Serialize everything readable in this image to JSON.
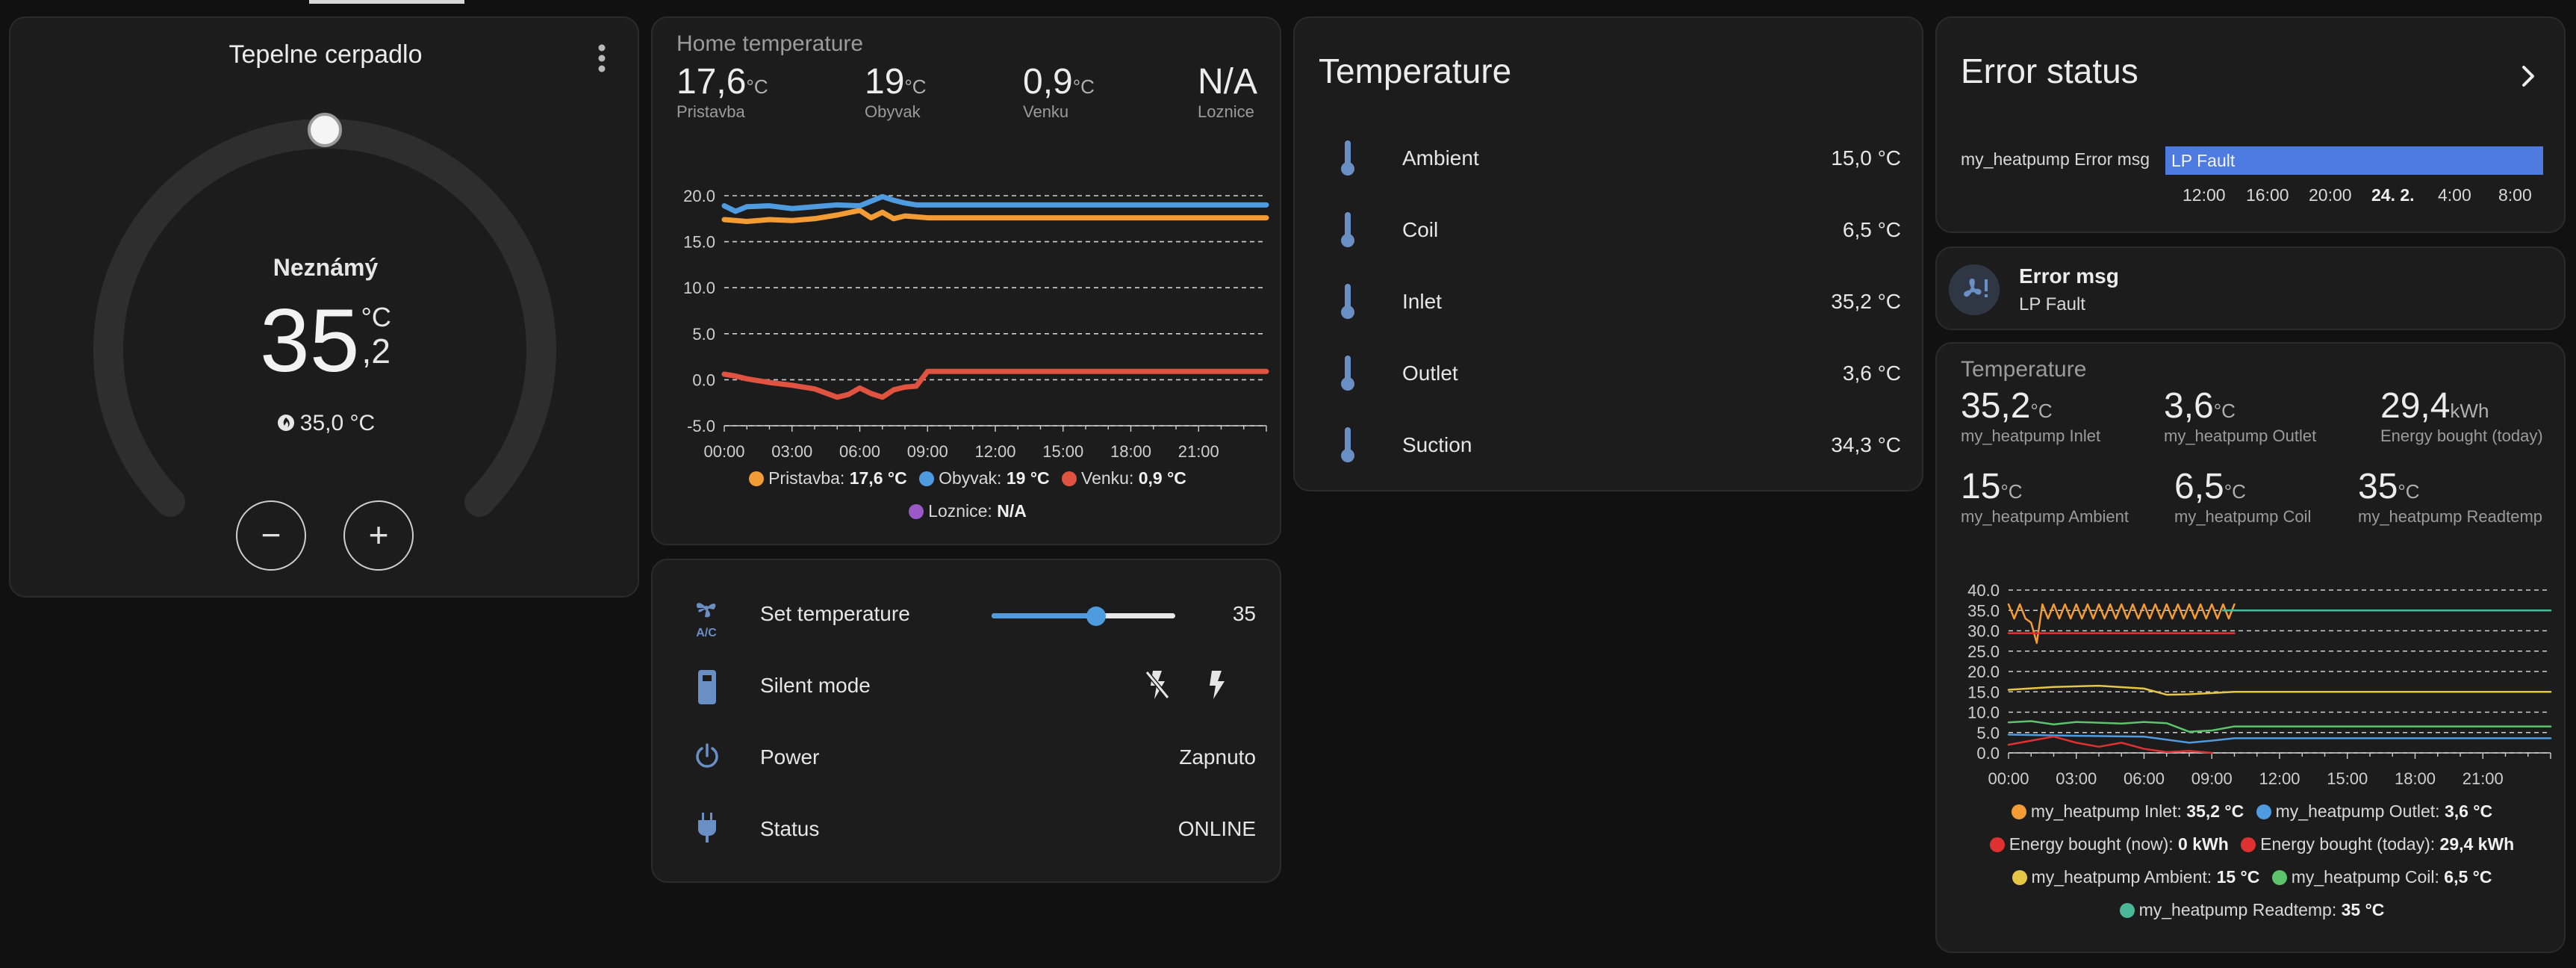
{
  "colors": {
    "orange": "#f39c35",
    "blue": "#4f9be0",
    "red": "#e05340",
    "purple": "#9b59c6",
    "accent_blue": "#4d7be0",
    "icon_blue": "#6a8fc4",
    "yellow": "#e6c645",
    "green": "#5cc46a",
    "teal": "#4bb89a",
    "bright_red": "#e03030"
  },
  "thermostat": {
    "title": "Tepelne cerpadlo",
    "state": "Neznámý",
    "temp_int": "35",
    "temp_dec": ",2",
    "unit": "°C",
    "target": "35,0 °C",
    "target_icon": "flame-icon",
    "minus": "−",
    "plus": "+",
    "menu_icon": "more-vertical-icon"
  },
  "home": {
    "title": "Home temperature",
    "sensors": [
      {
        "value": "17,6",
        "unit": "°C",
        "name": "Pristavba"
      },
      {
        "value": "19",
        "unit": "°C",
        "name": "Obyvak"
      },
      {
        "value": "0,9",
        "unit": "°C",
        "name": "Venku"
      },
      {
        "value": "N/A",
        "unit": "",
        "name": "Loznice"
      }
    ],
    "legend": [
      {
        "label": "Pristavba: ",
        "value": "17,6 °C",
        "color": "#f39c35"
      },
      {
        "label": "Obyvak: ",
        "value": "19 °C",
        "color": "#4f9be0"
      },
      {
        "label": "Venku: ",
        "value": "0,9 °C",
        "color": "#e05340"
      },
      {
        "label": "Loznice: ",
        "value": "N/A",
        "color": "#9b59c6"
      }
    ]
  },
  "controls": {
    "rows": [
      {
        "label": "Set temperature",
        "value": "35",
        "icon": "fan-ac-icon"
      },
      {
        "label": "Silent mode",
        "value": "",
        "icon": "remote-icon"
      },
      {
        "label": "Power",
        "value": "Zapnuto",
        "icon": "power-icon"
      },
      {
        "label": "Status",
        "value": "ONLINE",
        "icon": "plug-icon"
      }
    ],
    "slider": {
      "min": 0,
      "max": 100,
      "fraction": 0.57
    },
    "silent_off_icon": "flash-off-icon",
    "silent_on_icon": "flash-icon"
  },
  "temperature_card": {
    "title": "Temperature",
    "rows": [
      {
        "label": "Ambient",
        "value": "15,0 °C",
        "icon": "thermometer-icon"
      },
      {
        "label": "Coil",
        "value": "6,5 °C",
        "icon": "thermometer-icon"
      },
      {
        "label": "Inlet",
        "value": "35,2 °C",
        "icon": "thermometer-icon"
      },
      {
        "label": "Outlet",
        "value": "3,6 °C",
        "icon": "thermometer-icon"
      },
      {
        "label": "Suction",
        "value": "34,3 °C",
        "icon": "thermometer-icon"
      }
    ]
  },
  "error_status": {
    "title": "Error status",
    "arrow_icon": "chevron-right-icon",
    "entity": "my_heatpump Error msg",
    "bar_text": "LP Fault",
    "ticks": [
      "12:00",
      "16:00",
      "20:00",
      "24. 2.",
      "4:00",
      "8:00"
    ]
  },
  "error_msg": {
    "name": "Error msg",
    "value": "LP Fault",
    "icon": "fan-alert-icon"
  },
  "hp_temperature": {
    "title": "Temperature",
    "sensors": [
      {
        "value": "35,2",
        "unit": "°C",
        "name": "my_heatpump Inlet"
      },
      {
        "value": "3,6",
        "unit": "°C",
        "name": "my_heatpump Outlet"
      },
      {
        "value": "29,4",
        "unit": "kWh",
        "name": "Energy bought (today)"
      },
      {
        "value": "15",
        "unit": "°C",
        "name": "my_heatpump Ambient"
      },
      {
        "value": "6,5",
        "unit": "°C",
        "name": "my_heatpump Coil"
      },
      {
        "value": "35",
        "unit": "°C",
        "name": "my_heatpump Readtemp"
      }
    ],
    "legend": [
      {
        "label": "my_heatpump Inlet: ",
        "value": "35,2 °C",
        "color": "#f39c35"
      },
      {
        "label": "my_heatpump Outlet: ",
        "value": "3,6 °C",
        "color": "#4f9be0"
      },
      {
        "label": "Energy bought (now): ",
        "value": "0 kWh",
        "color": "#e03030"
      },
      {
        "label": "Energy bought (today): ",
        "value": "29,4 kWh",
        "color": "#e03030"
      },
      {
        "label": "my_heatpump Ambient: ",
        "value": "15 °C",
        "color": "#e6c645"
      },
      {
        "label": "my_heatpump Coil: ",
        "value": "6,5 °C",
        "color": "#5cc46a"
      },
      {
        "label": "my_heatpump Readtemp: ",
        "value": "35 °C",
        "color": "#4bb89a"
      }
    ]
  },
  "chart_data": [
    {
      "type": "line",
      "x_ticks": [
        "00:00",
        "03:00",
        "06:00",
        "09:00",
        "12:00",
        "15:00",
        "18:00",
        "21:00"
      ],
      "y_ticks": [
        "20.0",
        "15.0",
        "10.0",
        "5.0",
        "0.0",
        "-5.0"
      ],
      "ylim": [
        -5,
        20
      ],
      "xlim": [
        0,
        24
      ],
      "grid": true,
      "series": [
        {
          "name": "Pristavba",
          "color": "#f39c35",
          "x": [
            0,
            1,
            2,
            3,
            4,
            5,
            6,
            6.5,
            7,
            7.5,
            8,
            9,
            12,
            24
          ],
          "y": [
            17.4,
            17.2,
            17.4,
            17.3,
            17.5,
            17.9,
            18.4,
            17.6,
            18.2,
            17.5,
            17.8,
            17.6,
            17.6,
            17.6
          ]
        },
        {
          "name": "Obyvak",
          "color": "#4f9be0",
          "x": [
            0,
            0.5,
            1,
            2,
            3,
            4,
            5,
            6,
            6.5,
            7,
            7.5,
            8,
            8.5,
            9,
            24
          ],
          "y": [
            18.9,
            18.3,
            18.8,
            18.9,
            18.6,
            18.8,
            19.0,
            18.9,
            19.4,
            19.9,
            19.5,
            19.2,
            19.0,
            19.0,
            19.0
          ]
        },
        {
          "name": "Venku",
          "color": "#e05340",
          "x": [
            0,
            0.5,
            1,
            2,
            3,
            4,
            5,
            5.5,
            6,
            6.5,
            7,
            7.5,
            8,
            8.5,
            9,
            10,
            24
          ],
          "y": [
            0.6,
            0.4,
            0.1,
            -0.3,
            -0.6,
            -1.0,
            -1.9,
            -1.6,
            -0.9,
            -1.5,
            -1.9,
            -1.1,
            -0.8,
            -0.7,
            0.9,
            0.9,
            0.9
          ]
        }
      ]
    },
    {
      "type": "line",
      "x_ticks": [
        "00:00",
        "03:00",
        "06:00",
        "09:00",
        "12:00",
        "15:00",
        "18:00",
        "21:00"
      ],
      "y_ticks": [
        "40.0",
        "35.0",
        "30.0",
        "25.0",
        "20.0",
        "15.0",
        "10.0",
        "5.0",
        "0.0"
      ],
      "ylim": [
        0,
        40
      ],
      "xlim": [
        0,
        24
      ],
      "grid": true,
      "series": [
        {
          "name": "my_heatpump Inlet",
          "color": "#f39c35",
          "zigzag": [
            0,
            10,
            33,
            36.5
          ],
          "y_end": 35.2
        },
        {
          "name": "my_heatpump Readtemp",
          "color": "#4bb89a",
          "x": [
            9.5,
            24
          ],
          "y": [
            35,
            35
          ]
        },
        {
          "name": "Energy bought (today)",
          "color": "#e03030",
          "x": [
            0,
            10
          ],
          "y": [
            29.4,
            29.4
          ]
        },
        {
          "name": "my_heatpump Ambient",
          "color": "#e6c645",
          "x": [
            0,
            2,
            4,
            6,
            7,
            8,
            9,
            10,
            24
          ],
          "y": [
            15.5,
            16.2,
            16.5,
            15.8,
            14.3,
            14.4,
            14.7,
            15.0,
            15.0
          ]
        },
        {
          "name": "my_heatpump Coil",
          "color": "#5cc46a",
          "x": [
            0,
            1,
            2,
            3,
            4,
            5,
            6,
            7,
            8,
            9,
            10,
            24
          ],
          "y": [
            7.5,
            7.8,
            7.0,
            7.6,
            7.4,
            7.2,
            7.6,
            7.3,
            5.2,
            5.5,
            6.5,
            6.5
          ]
        },
        {
          "name": "my_heatpump Outlet",
          "color": "#4f9be0",
          "x": [
            0,
            3,
            6,
            8,
            9,
            10,
            24
          ],
          "y": [
            4.5,
            4.2,
            4.0,
            2.5,
            3.0,
            3.6,
            3.6
          ]
        },
        {
          "name": "Energy bought (now)",
          "color": "#e03030",
          "x": [
            0,
            1,
            2,
            3,
            4,
            5,
            6,
            7,
            8,
            9
          ],
          "y": [
            2.0,
            3.0,
            4.0,
            2.5,
            1.5,
            2.5,
            1.0,
            0.2,
            0.5,
            0
          ]
        }
      ]
    }
  ]
}
